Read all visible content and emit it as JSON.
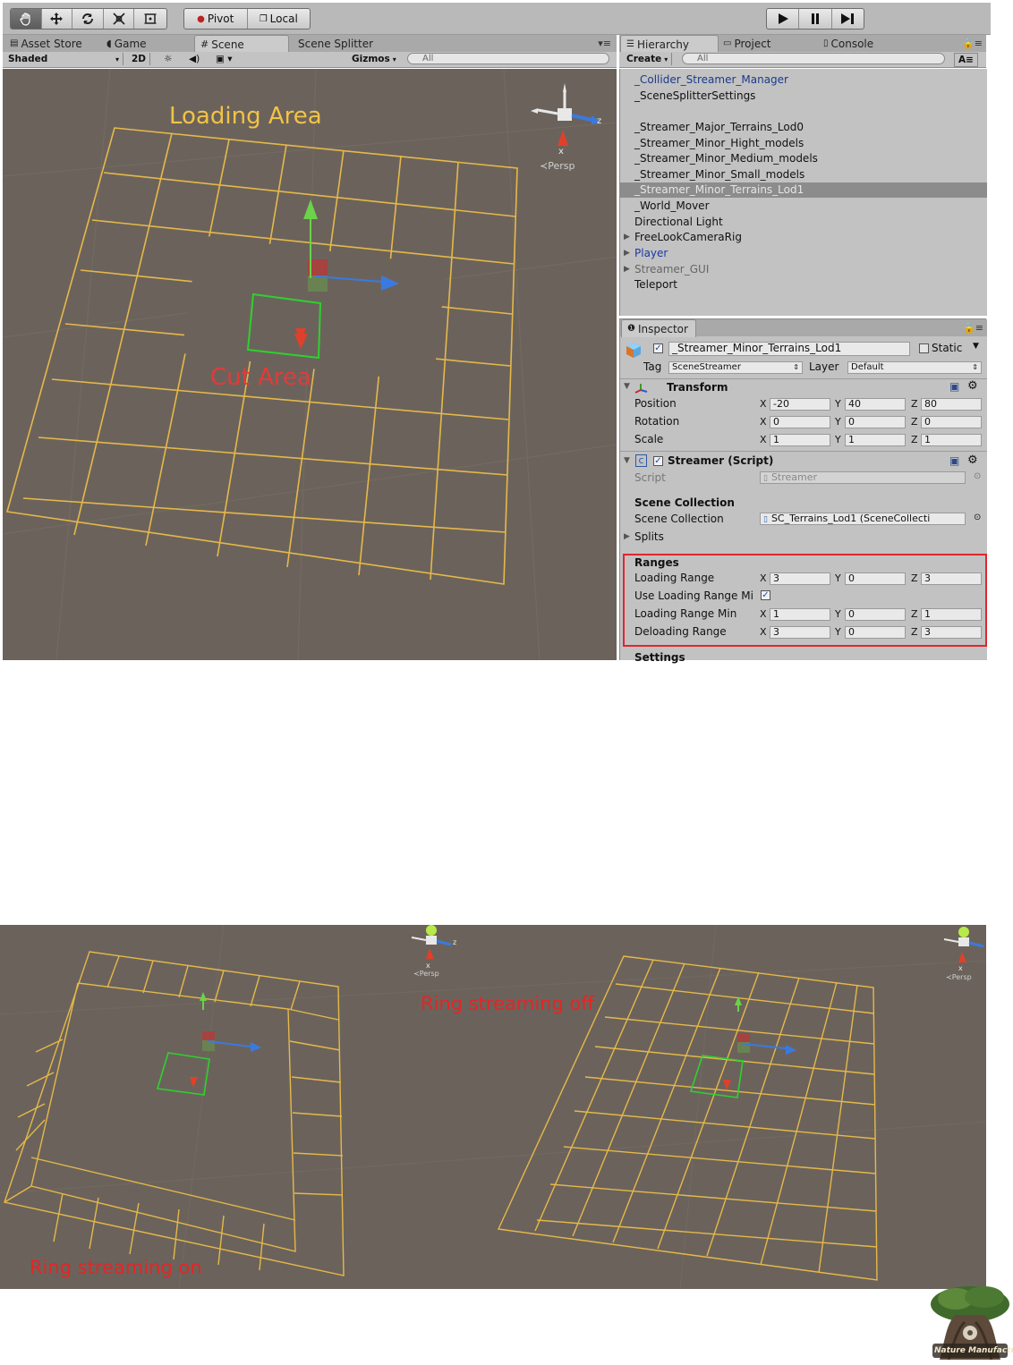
{
  "toolbar": {
    "pivot_label": "Pivot",
    "local_label": "Local"
  },
  "scene_tabs": {
    "asset_store": "Asset Store",
    "game": "Game",
    "scene": "Scene",
    "scene_splitter": "Scene Splitter"
  },
  "scene_bar": {
    "shaded": "Shaded",
    "mode_2d": "2D",
    "gizmos": "Gizmos",
    "search_placeholder": "All"
  },
  "right_tabs": {
    "hierarchy": "Hierarchy",
    "project": "Project",
    "console": "Console"
  },
  "hierarchy_bar": {
    "create": "Create",
    "search_placeholder": "All"
  },
  "hierarchy": {
    "items": [
      {
        "label": "_Collider_Streamer_Manager",
        "highlight": true
      },
      {
        "label": "_SceneSplitterSettings"
      },
      {
        "label": "_Streamer_Major_Terrains_Lod0"
      },
      {
        "label": "_Streamer_Minor_Hight_models"
      },
      {
        "label": "_Streamer_Minor_Medium_models"
      },
      {
        "label": "_Streamer_Minor_Small_models"
      },
      {
        "label": "_Streamer_Minor_Terrains_Lod1",
        "selected": true
      },
      {
        "label": "_World_Mover"
      },
      {
        "label": "Directional Light"
      },
      {
        "label": "FreeLookCameraRig",
        "arrow": true
      },
      {
        "label": "Player",
        "arrow": true,
        "highlight": true
      },
      {
        "label": "Streamer_GUI",
        "arrow": true,
        "dim": true
      },
      {
        "label": "Teleport"
      }
    ]
  },
  "inspector": {
    "tab": "Inspector",
    "object_name": "_Streamer_Minor_Terrains_Lod1",
    "static_label": "Static",
    "tag_label": "Tag",
    "tag_value": "SceneStreamer",
    "layer_label": "Layer",
    "layer_value": "Default",
    "transform": {
      "title": "Transform",
      "position_label": "Position",
      "rotation_label": "Rotation",
      "scale_label": "Scale",
      "position": [
        "-20",
        "40",
        "80"
      ],
      "rotation": [
        "0",
        "0",
        "0"
      ],
      "scale": [
        "1",
        "1",
        "1"
      ]
    },
    "streamer": {
      "title": "Streamer (Script)",
      "script_label": "Script",
      "script_value": "Streamer",
      "scene_collection_header": "Scene Collection",
      "scene_collection_label": "Scene Collection",
      "scene_collection_value": "SC_Terrains_Lod1 (SceneCollecti",
      "splits_label": "Splits",
      "ranges_header": "Ranges",
      "loading_range_label": "Loading Range",
      "loading_range": [
        "3",
        "0",
        "3"
      ],
      "use_loading_range_min_label": "Use Loading Range Mi",
      "loading_range_min_label": "Loading Range Min",
      "loading_range_min": [
        "1",
        "0",
        "1"
      ],
      "deloading_range_label": "Deloading Range",
      "deloading_range": [
        "3",
        "0",
        "3"
      ],
      "settings_header": "Settings"
    },
    "axes": [
      "X",
      "Y",
      "Z"
    ]
  },
  "scene": {
    "persp_label": "Persp",
    "gizmo_z": "z",
    "gizmo_x": "x"
  },
  "annotations": {
    "loading_area": "Loading Area",
    "cut_area": "Cut Area",
    "ring_on": "Ring streaming on",
    "ring_off": "Ring streaming off"
  },
  "logo": {
    "text": "Nature Manufacture"
  },
  "colors": {
    "grid_yellow": "#e6b84a",
    "loading_area_text": "#f2c347",
    "cut_area_text": "#e33a3a",
    "ring_text": "#e42525",
    "highlight_box": "#e0262e",
    "scene_bg": "#6b635b",
    "panel_bg": "#c2c2c2"
  }
}
